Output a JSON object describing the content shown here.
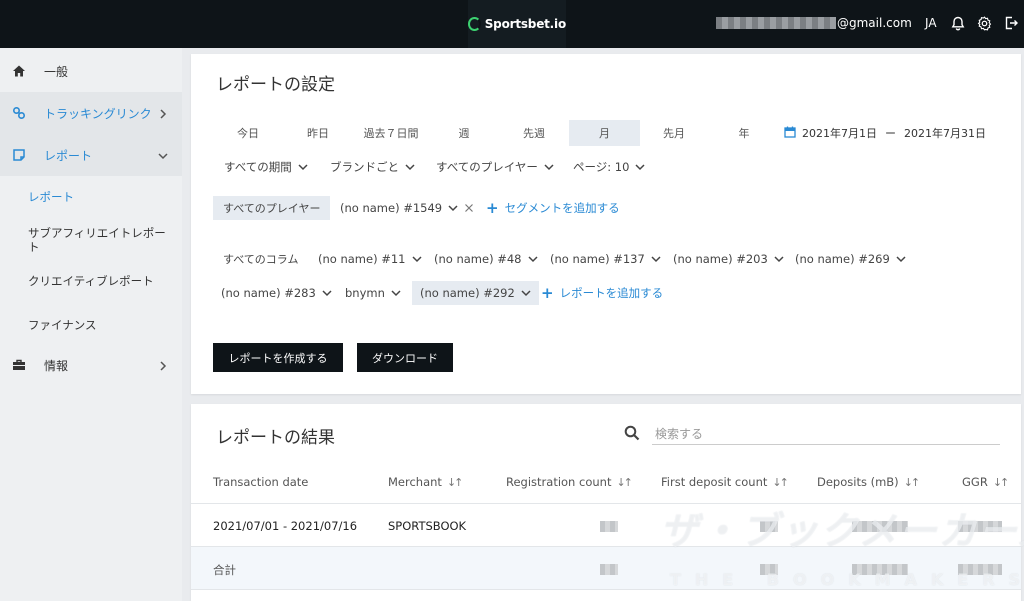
{
  "header": {
    "logo_text": "Sportsbet.io",
    "email_suffix": "@gmail.com",
    "lang": "JA",
    "icons": [
      "bell-icon",
      "gear-icon",
      "logout-icon"
    ]
  },
  "sidebar": {
    "items": [
      {
        "label": "一般",
        "icon": "home-icon"
      },
      {
        "label": "トラッキングリンク",
        "icon": "link-icon"
      },
      {
        "label": "レポート",
        "icon": "report-icon"
      },
      {
        "label": "情報",
        "icon": "briefcase-icon"
      }
    ],
    "sub_items": [
      {
        "label": "レポート"
      },
      {
        "label": "サブアフィリエイトレポート"
      },
      {
        "label": "クリエイティブレポート"
      },
      {
        "label": "ファイナンス"
      }
    ]
  },
  "settings": {
    "title": "レポートの設定",
    "periods": [
      "今日",
      "昨日",
      "過去７日間",
      "週",
      "先週",
      "月",
      "先月",
      "年"
    ],
    "selected_period": "月",
    "date_from": "2021年7月1日",
    "date_sep": "ー",
    "date_to": "2021年7月31日",
    "filters": [
      "すべての期間",
      "ブランドごと",
      "すべてのプレイヤー",
      "ページ: 10"
    ],
    "segment_chip": "すべてのプレイヤー",
    "segment_select": "(no name) #1549",
    "add_segment": "セグメントを追加する",
    "columns_label": "すべてのコラム",
    "columns_row1": [
      "(no name) #11",
      "(no name) #48",
      "(no name) #137",
      "(no name) #203",
      "(no name) #269"
    ],
    "columns_row2": [
      "(no name) #283",
      "bnymn",
      "(no name) #292"
    ],
    "add_report": "レポートを追加する",
    "create_button": "レポートを作成する",
    "download_button": "ダウンロード"
  },
  "results": {
    "title": "レポートの結果",
    "search_placeholder": "検索する",
    "columns": [
      "Transaction date",
      "Merchant",
      "Registration count",
      "First deposit count",
      "Deposits (mB)",
      "GGR"
    ],
    "rows": [
      {
        "date": "2021/07/01 - 2021/07/16",
        "merchant": "SPORTSBOOK"
      }
    ],
    "total_label": "合計"
  },
  "watermark": {
    "main": "ザ・ブックメーカーズ",
    "sub": "THE BOOKMAKERS"
  }
}
